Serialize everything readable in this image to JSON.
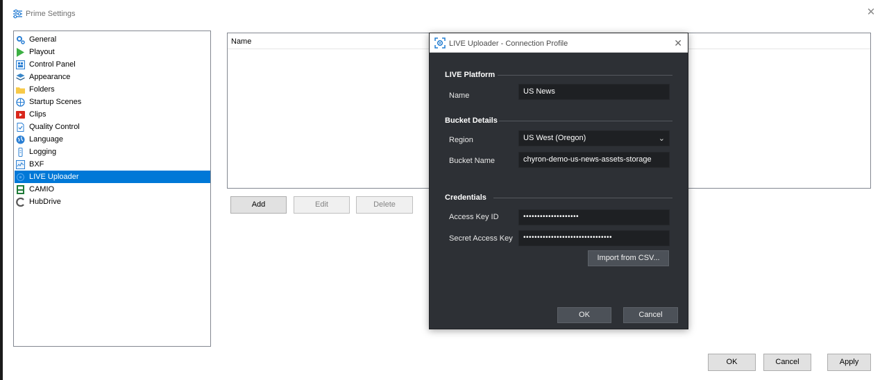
{
  "window": {
    "title": "Prime Settings",
    "close_glyph": "✕"
  },
  "sidebar": {
    "items": [
      {
        "label": "General",
        "icon": "gear-icon"
      },
      {
        "label": "Playout",
        "icon": "play-icon"
      },
      {
        "label": "Control Panel",
        "icon": "control-panel-icon"
      },
      {
        "label": "Appearance",
        "icon": "layers-icon"
      },
      {
        "label": "Folders",
        "icon": "folder-icon"
      },
      {
        "label": "Startup Scenes",
        "icon": "scene-icon"
      },
      {
        "label": "Clips",
        "icon": "clip-icon"
      },
      {
        "label": "Quality Control",
        "icon": "quality-icon"
      },
      {
        "label": "Language",
        "icon": "globe-icon"
      },
      {
        "label": "Logging",
        "icon": "logging-icon"
      },
      {
        "label": "BXF",
        "icon": "bxf-icon"
      },
      {
        "label": "LIVE Uploader",
        "icon": "uploader-icon",
        "selected": true
      },
      {
        "label": "CAMIO",
        "icon": "camio-icon"
      },
      {
        "label": "HubDrive",
        "icon": "hubdrive-icon"
      }
    ]
  },
  "profiles": {
    "column_name": "Name",
    "add_label": "Add",
    "edit_label": "Edit",
    "delete_label": "Delete"
  },
  "footer": {
    "ok_label": "OK",
    "cancel_label": "Cancel",
    "apply_label": "Apply"
  },
  "dialog": {
    "title": "LIVE Uploader - Connection Profile",
    "close_glyph": "✕",
    "live_platform": {
      "section_title": "LIVE Platform",
      "name_label": "Name",
      "name_value": "US News"
    },
    "bucket": {
      "section_title": "Bucket Details",
      "region_label": "Region",
      "region_value": "US West (Oregon)",
      "bucket_name_label": "Bucket Name",
      "bucket_name_value": "chyron-demo-us-news-assets-storage"
    },
    "credentials": {
      "section_title": "Credentials",
      "access_key_label": "Access Key ID",
      "access_key_value": "••••••••••••••••••••",
      "secret_key_label": "Secret Access Key",
      "secret_key_value": "••••••••••••••••••••••••••••••••",
      "import_label": "Import from CSV..."
    },
    "ok_label": "OK",
    "cancel_label": "Cancel"
  }
}
